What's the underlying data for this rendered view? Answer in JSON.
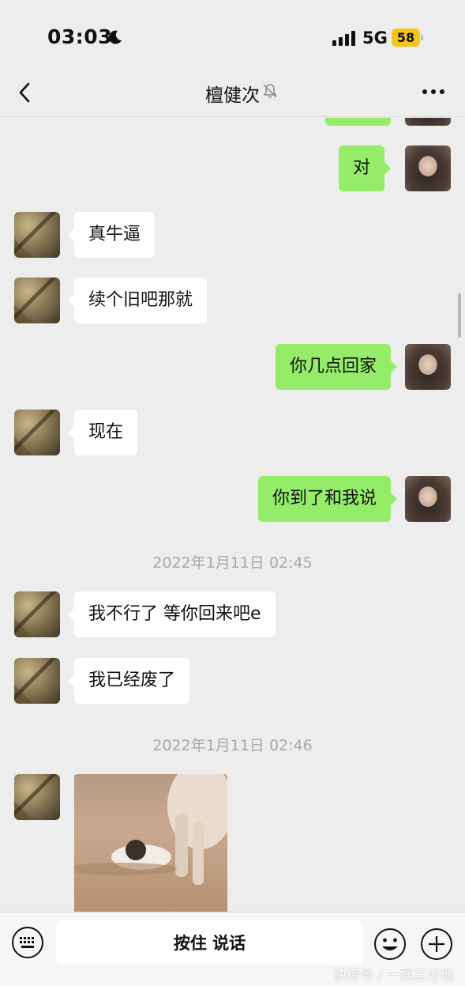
{
  "status_bar": {
    "time": "03:03",
    "network": "5G",
    "battery": "58",
    "icons": [
      "moon-icon",
      "signal-icon"
    ]
  },
  "nav": {
    "title": "檀健次",
    "icons": [
      "back-icon",
      "mute-icon",
      "more-icon"
    ]
  },
  "messages": [
    {
      "side": "out",
      "text": "对"
    },
    {
      "side": "in",
      "text": "真牛逼"
    },
    {
      "side": "in",
      "text": "续个旧吧那就"
    },
    {
      "side": "out",
      "text": "你几点回家"
    },
    {
      "side": "in",
      "text": "现在"
    },
    {
      "side": "out",
      "text": "你到了和我说"
    },
    {
      "side": "in",
      "text": "我不行了 等你回来吧e"
    },
    {
      "side": "in",
      "text": "我已经废了"
    }
  ],
  "timestamps": [
    "2022年1月11日 02:45",
    "2022年1月11日 02:46"
  ],
  "input_bar": {
    "voice_label": "按住 说话",
    "icons": [
      "keyboard-icon",
      "emoji-icon",
      "plus-icon"
    ]
  },
  "colors": {
    "background": "#ededed",
    "bubble_out": "#95ec69",
    "bubble_in": "#ffffff",
    "battery": "#f5c518"
  },
  "watermark": "快传号 / 一娱三分地"
}
